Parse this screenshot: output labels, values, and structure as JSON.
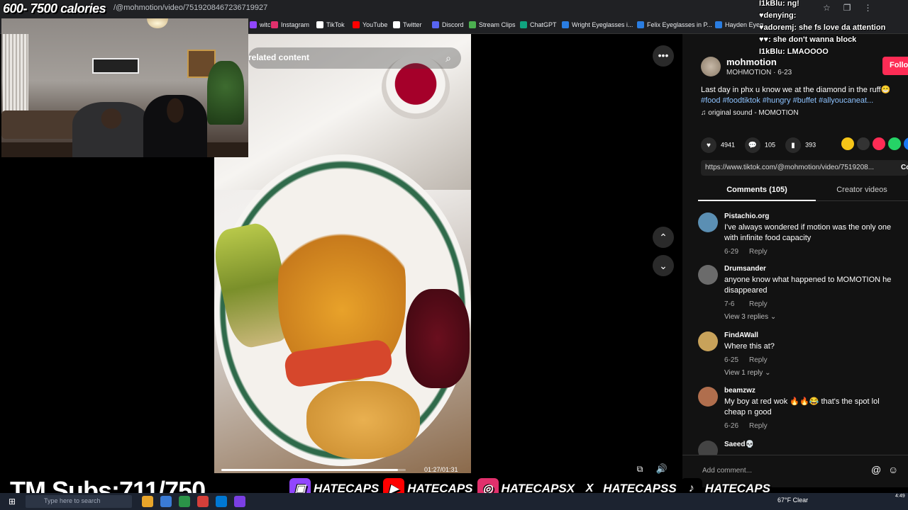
{
  "overlay": {
    "title": "600- 7500 calories",
    "subs": "TM Subs:711/750"
  },
  "browser": {
    "url": "/@mohmotion/video/7519208467236719927",
    "bookmarks": [
      {
        "label": "witch",
        "color": "#9146ff"
      },
      {
        "label": "Instagram",
        "color": "#e1306c"
      },
      {
        "label": "TikTok",
        "color": "#ffffff"
      },
      {
        "label": "YouTube",
        "color": "#ff0000"
      },
      {
        "label": "Twitter",
        "color": "#ffffff"
      },
      {
        "label": "Discord",
        "color": "#5865f2"
      },
      {
        "label": "Stream Clips",
        "color": "#4caf50"
      },
      {
        "label": "ChatGPT",
        "color": "#10a37f"
      },
      {
        "label": "Wright Eyeglasses i...",
        "color": "#2a7de1"
      },
      {
        "label": "Felix Eyeglasses in P...",
        "color": "#2a7de1"
      },
      {
        "label": "Hayden Eyeg",
        "color": "#2a7de1"
      }
    ]
  },
  "chat": [
    {
      "text": "I1kBlu: ng!"
    },
    {
      "text": "♥denying:"
    },
    {
      "text": "♥adoremj: she fs love da attention"
    },
    {
      "text": "♥♥: she don't wanna block"
    },
    {
      "text": "I1kBlu: LMAOOOO"
    }
  ],
  "video": {
    "related_text": "related content",
    "time": "01:27/01:31",
    "progress": 0.956
  },
  "post": {
    "author": "mohmotion",
    "author_sub": "MOHMOTION · 6-23",
    "follow": "Follow",
    "caption": "Last day in phx u know we at the diamond in the ruff😁",
    "tags": "#food #foodtiktok #hungry #buffet #allyoucaneat...",
    "sound": "♫ original sound - MOMOTION",
    "likes": "4941",
    "comments_count": "105",
    "saves": "393",
    "link": "https://www.tiktok.com/@mohmotion/video/7519208...",
    "copy": "Copy"
  },
  "tabs": {
    "comments": "Comments (105)",
    "creator": "Creator videos"
  },
  "comments": [
    {
      "user": "Pistachio.org",
      "text": "I've always wondered if motion was the only one with infinite food capacity",
      "date": "6-29",
      "reply": "Reply",
      "view": "",
      "avatar": "#5b8fb3"
    },
    {
      "user": "Drumsander",
      "text": "anyone know what happened to MOMOTION he disappeared",
      "date": "7-6",
      "reply": "Reply",
      "view": "View 3 replies ⌄",
      "avatar": "#6b6b6b"
    },
    {
      "user": "FindAWall",
      "text": "Where this at?",
      "date": "6-25",
      "reply": "Reply",
      "view": "View 1 reply ⌄",
      "avatar": "#c8a25a"
    },
    {
      "user": "beamzwz",
      "text": "My boy at red wok 🔥🔥😂 that's the spot lol cheap n good",
      "date": "6-26",
      "reply": "Reply",
      "view": "",
      "avatar": "#b06e4d"
    },
    {
      "user": "Saeed💀",
      "text": "",
      "date": "",
      "reply": "",
      "view": "",
      "avatar": "#444444"
    }
  ],
  "add_comment": "Add comment...",
  "socials": [
    {
      "label": "HATECAPS",
      "color": "#9146ff",
      "icon": "twitch-icon"
    },
    {
      "label": "HATECAPS",
      "color": "#ff0000",
      "icon": "youtube-icon"
    },
    {
      "label": "HATECAPSX",
      "color": "#e1306c",
      "icon": "instagram-icon"
    },
    {
      "label": "HATECAPSS",
      "color": "#000000",
      "icon": "x-icon"
    },
    {
      "label": "HATECAPS_",
      "color": "#000000",
      "icon": "tiktok-icon"
    }
  ],
  "taskbar": {
    "search": "Type here to search",
    "weather": "67°F Clear",
    "clock": "4:49"
  }
}
